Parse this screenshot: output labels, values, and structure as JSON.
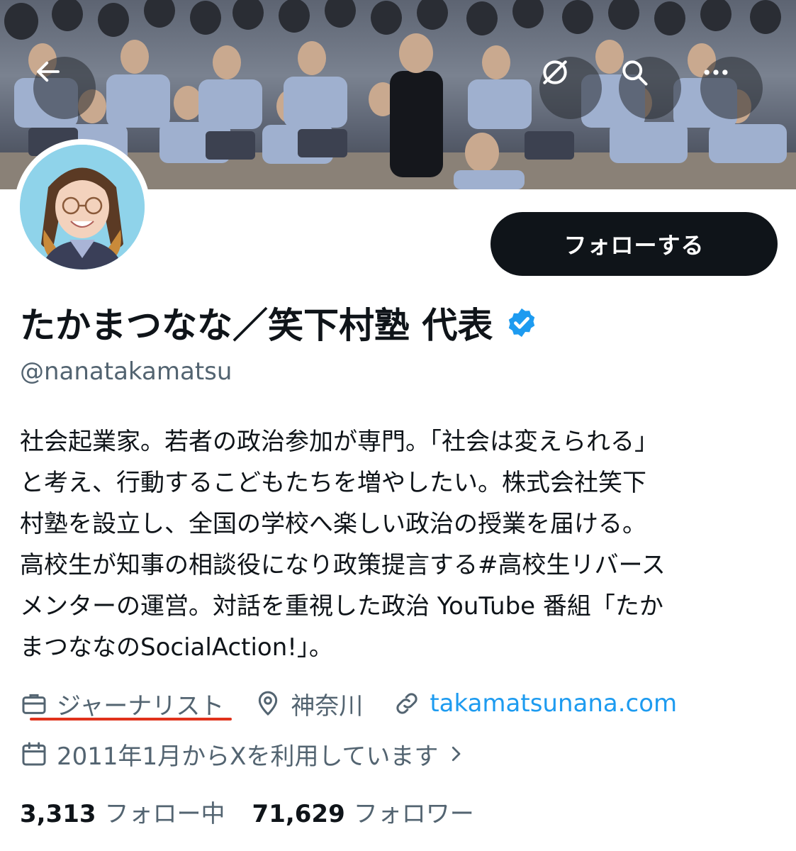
{
  "banner": {
    "back_icon": "arrow-left-icon",
    "notify_icon": "bell-off-icon",
    "search_icon": "search-icon",
    "more_icon": "more-horizontal-icon"
  },
  "profile": {
    "follow_label": "フォローする",
    "display_name": "たかまつなな／笑下村塾 代表",
    "verified_icon": "verified-badge-icon",
    "verified_color": "#1d9bf0",
    "handle": "@nanatakamatsu",
    "bio_lines": [
      "社会起業家。若者の政治参加が専門。「社会は変えられる」",
      "と考え、行動するこどもたちを増やしたい。株式会社笑下",
      "村塾を設立し、全国の学校へ楽しい政治の授業を届ける。",
      "高校生が知事の相談役になり政策提言する#高校生リバース",
      "メンターの運営。対話を重視した政治 YouTube 番組「たか",
      "まつななのSocialAction!」。"
    ],
    "profession_icon": "briefcase-icon",
    "profession": "ジャーナリスト",
    "location_icon": "location-pin-icon",
    "location": "神奈川",
    "link_icon": "link-icon",
    "website": "takamatsunana.com",
    "joined_icon": "calendar-icon",
    "joined": "2011年1月からXを利用しています",
    "following_count": "3,313",
    "following_label": "フォロー中",
    "followers_count": "71,629",
    "followers_label": "フォロワー"
  },
  "colors": {
    "link": "#1d9bf0",
    "secondary_text": "#536471",
    "annotation_underline": "#e0321c"
  }
}
